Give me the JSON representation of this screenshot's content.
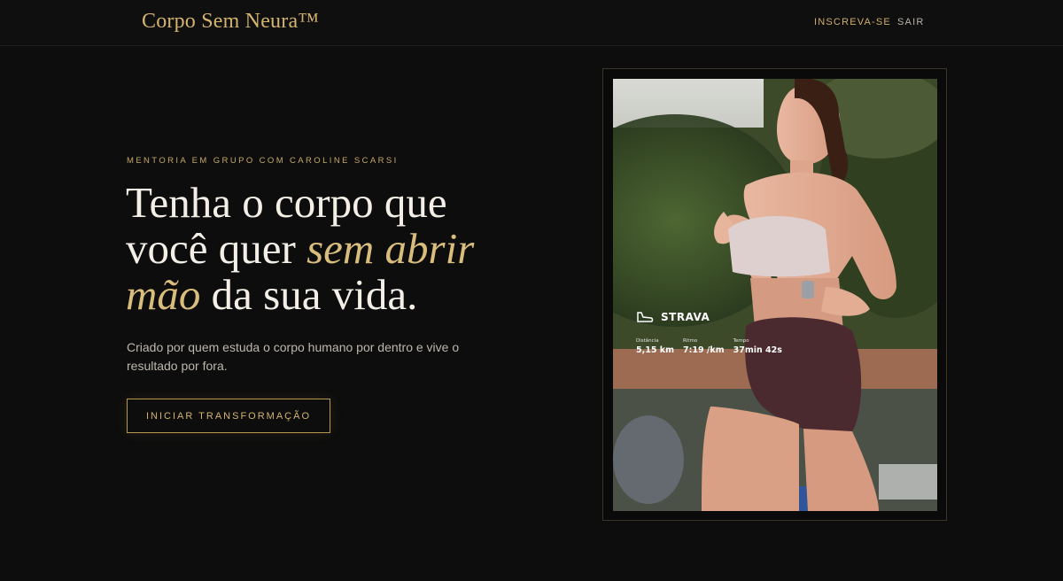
{
  "header": {
    "brand": "Corpo Sem Neura™",
    "nav": {
      "signup": "INSCREVA-SE",
      "exit": "SAIR"
    }
  },
  "hero": {
    "eyebrow": "MENTORIA EM GRUPO COM CAROLINE SCARSI",
    "headline": {
      "part1": "Tenha o corpo que você quer ",
      "accent1": "sem abrir mão",
      "part2": " da sua vida."
    },
    "subtitle": "Criado por quem estuda o corpo humano por dentro e vive o resultado por fora.",
    "cta": "INICIAR TRANSFORMAÇÃO"
  },
  "photo": {
    "strava": {
      "logo": "STRAVA",
      "stats": [
        {
          "label": "Distância",
          "value": "5,15 km"
        },
        {
          "label": "Ritmo",
          "value": "7:19 /km"
        },
        {
          "label": "Tempo",
          "value": "37min 42s"
        }
      ]
    }
  },
  "colors": {
    "background": "#0d0d0d",
    "gold": "#d3b36e",
    "text": "#f3efe7"
  }
}
